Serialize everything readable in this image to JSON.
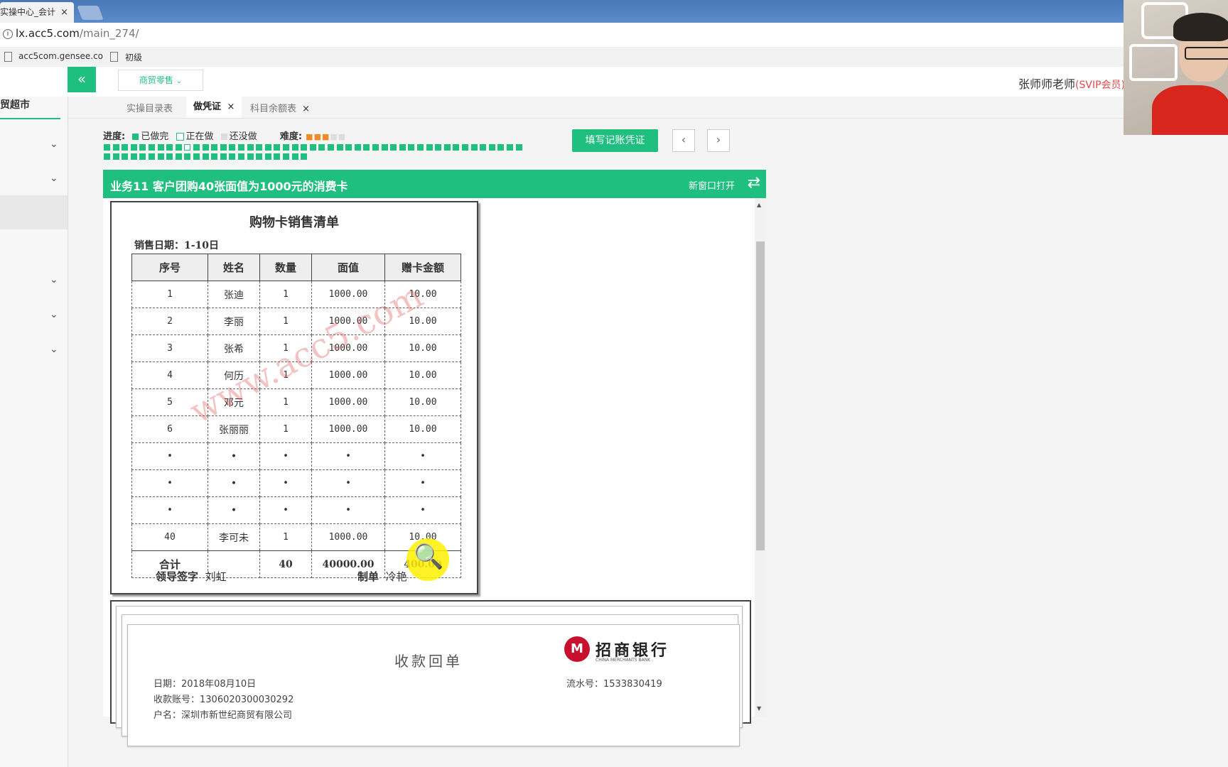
{
  "browser": {
    "tab_title": "实操中心_会计",
    "tab_close": "×",
    "url_host": "lx.acc5.com",
    "url_path": "/main_274/",
    "bookmarks": [
      "acc5com.gensee.co",
      "初级"
    ]
  },
  "app": {
    "collapse_icon": "«",
    "dropdown_label": "商贸零售",
    "user_name": "张师师老师",
    "user_badge": "(SVIP会员)",
    "sidebar_title": "贸超市"
  },
  "subtabs": [
    {
      "label": "实操目录表",
      "closable": false
    },
    {
      "label": "做凭证",
      "closable": true
    },
    {
      "label": "科目余额表",
      "closable": true
    }
  ],
  "progress": {
    "label": "进度:",
    "done": "已做完",
    "doing": "正在做",
    "todo": "还没做",
    "difficulty_label": "难度:",
    "difficulty_stars": 3,
    "difficulty_max": 5
  },
  "actions": {
    "fill_voucher": "填写记账凭证",
    "prev": "‹",
    "next": "›"
  },
  "business": {
    "title": "业务11 客户团购40张面值为1000元的消费卡",
    "open_new_window": "新窗口打开",
    "swap_icon": "⇄"
  },
  "sales_sheet": {
    "title": "购物卡销售清单",
    "date_label": "销售日期：1-10日",
    "headers": [
      "序号",
      "姓名",
      "数量",
      "面值",
      "赠卡金额"
    ],
    "rows": [
      [
        "1",
        "张迪",
        "1",
        "1000.00",
        "10.00"
      ],
      [
        "2",
        "李丽",
        "1",
        "1000.00",
        "10.00"
      ],
      [
        "3",
        "张希",
        "1",
        "1000.00",
        "10.00"
      ],
      [
        "4",
        "何历",
        "1",
        "1000.00",
        "10.00"
      ],
      [
        "5",
        "邓元",
        "1",
        "1000.00",
        "10.00"
      ],
      [
        "6",
        "张丽丽",
        "1",
        "1000.00",
        "10.00"
      ],
      [
        "•",
        "•",
        "•",
        "•",
        "•"
      ],
      [
        "•",
        "•",
        "•",
        "•",
        "•"
      ],
      [
        "•",
        "•",
        "•",
        "•",
        "•"
      ],
      [
        "40",
        "李可未",
        "1",
        "1000.00",
        "10.00"
      ]
    ],
    "total": [
      "合计",
      "",
      "40",
      "40000.00",
      "400.00"
    ],
    "leader_label": "领导签字",
    "leader_name": "刘虹",
    "maker_label": "制单",
    "maker_name": "冷艳",
    "watermark": "www.acc5.com"
  },
  "receipt": {
    "title": "收款回单",
    "bank_name": "招商银行",
    "bank_en": "CHINA MERCHANTS BANK",
    "date": "日期：2018年08月10日",
    "account": "收款账号：1306020300030292",
    "payee": "户名：深圳市新世纪商贸有限公司",
    "serial": "流水号：1533830419"
  },
  "colors": {
    "accent": "#1fbf7f",
    "badge": "#e24a4a",
    "bank_red": "#c8102e"
  }
}
